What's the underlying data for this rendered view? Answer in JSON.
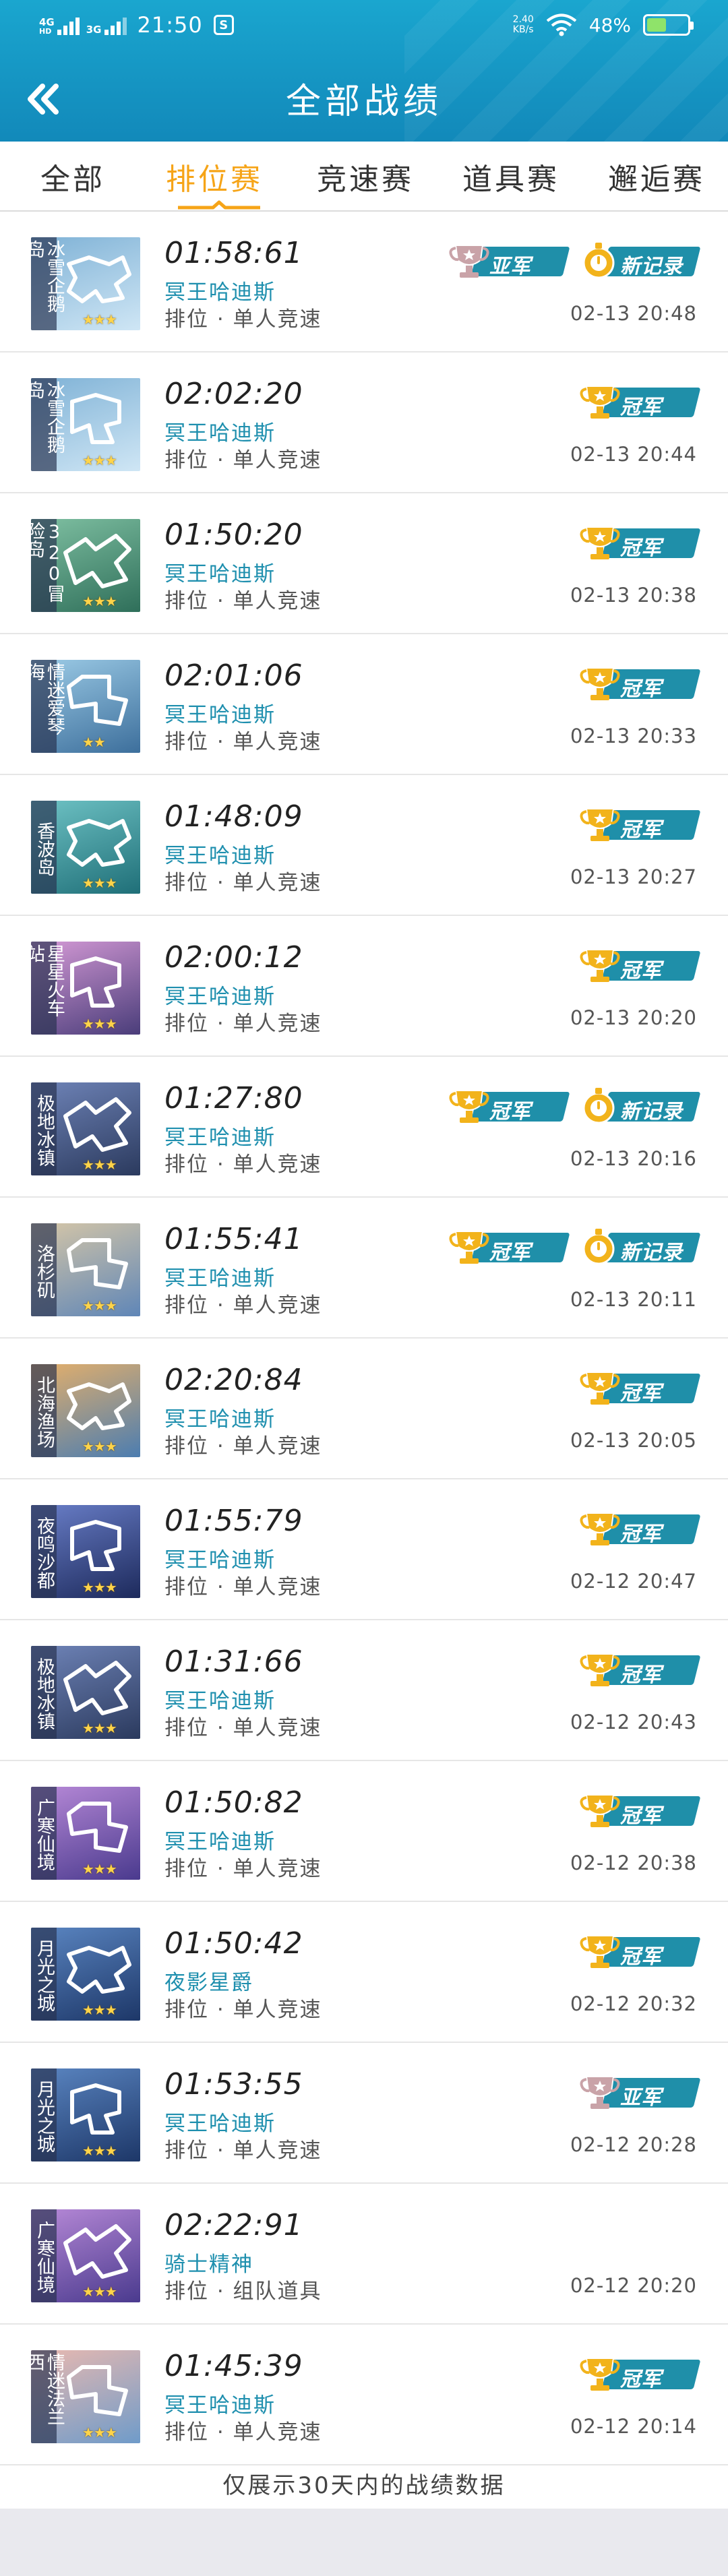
{
  "status_bar": {
    "network_left": "4G",
    "network_left_hd": "HD",
    "network_right": "3G",
    "time": "21:50",
    "app_icon_letter": "S",
    "speed_value": "2.40",
    "speed_unit": "KB/s",
    "battery_text": "48%",
    "battery_level": 0.48,
    "battery_color": "#8fe36a"
  },
  "header": {
    "title": "全部战绩",
    "back_icon": "double-chevron-left-icon",
    "bg_color": "#1594c2"
  },
  "tabs": [
    {
      "label": "全部",
      "active": false
    },
    {
      "label": "排位赛",
      "active": true
    },
    {
      "label": "竞速赛",
      "active": false
    },
    {
      "label": "道具赛",
      "active": false
    },
    {
      "label": "邂逅赛",
      "active": false
    }
  ],
  "colors": {
    "active_tab": "#f6a417",
    "car_name": "#1e8fae",
    "ribbon": "#1f8fa9",
    "gold": "#f2b31b",
    "silver": "#c9a3a8"
  },
  "records": [
    {
      "map": "冰雪企鹅岛",
      "stars": "★★★",
      "time": "01:58:61",
      "car": "冥王哈迪斯",
      "mode": "排位 · 单人竞速",
      "date": "02-13 20:48",
      "badges": [
        {
          "type": "silver",
          "label": "亚军"
        },
        {
          "type": "record",
          "label": "新记录"
        }
      ],
      "thumb": "snow"
    },
    {
      "map": "冰雪企鹅岛",
      "stars": "★★★",
      "time": "02:02:20",
      "car": "冥王哈迪斯",
      "mode": "排位 · 单人竞速",
      "date": "02-13 20:44",
      "badges": [
        {
          "type": "gold",
          "label": "冠军"
        }
      ],
      "thumb": "snow"
    },
    {
      "map": "320冒险岛",
      "stars": "★★★",
      "time": "01:50:20",
      "car": "冥王哈迪斯",
      "mode": "排位 · 单人竞速",
      "date": "02-13 20:38",
      "badges": [
        {
          "type": "gold",
          "label": "冠军"
        }
      ],
      "thumb": "green"
    },
    {
      "map": "情迷爱琴海",
      "stars": "★★",
      "time": "02:01:06",
      "car": "冥王哈迪斯",
      "mode": "排位 · 单人竞速",
      "date": "02-13 20:33",
      "badges": [
        {
          "type": "gold",
          "label": "冠军"
        }
      ],
      "thumb": "sea"
    },
    {
      "map": "香波岛",
      "stars": "★★★",
      "time": "01:48:09",
      "car": "冥王哈迪斯",
      "mode": "排位 · 单人竞速",
      "date": "02-13 20:27",
      "badges": [
        {
          "type": "gold",
          "label": "冠军"
        }
      ],
      "thumb": "teal"
    },
    {
      "map": "星星火车站",
      "stars": "★★★",
      "time": "02:00:12",
      "car": "冥王哈迪斯",
      "mode": "排位 · 单人竞速",
      "date": "02-13 20:20",
      "badges": [
        {
          "type": "gold",
          "label": "冠军"
        }
      ],
      "thumb": "purple"
    },
    {
      "map": "极地冰镇",
      "stars": "★★★",
      "time": "01:27:80",
      "car": "冥王哈迪斯",
      "mode": "排位 · 单人竞速",
      "date": "02-13 20:16",
      "badges": [
        {
          "type": "gold",
          "label": "冠军"
        },
        {
          "type": "record",
          "label": "新记录"
        }
      ],
      "thumb": "night"
    },
    {
      "map": "洛杉矶",
      "stars": "★★★",
      "time": "01:55:41",
      "car": "冥王哈迪斯",
      "mode": "排位 · 单人竞速",
      "date": "02-13 20:11",
      "badges": [
        {
          "type": "gold",
          "label": "冠军"
        },
        {
          "type": "record",
          "label": "新记录"
        }
      ],
      "thumb": "city"
    },
    {
      "map": "北海渔场",
      "stars": "★★★",
      "time": "02:20:84",
      "car": "冥王哈迪斯",
      "mode": "排位 · 单人竞速",
      "date": "02-13 20:05",
      "badges": [
        {
          "type": "gold",
          "label": "冠军"
        }
      ],
      "thumb": "harbor"
    },
    {
      "map": "夜鸣沙都",
      "stars": "★★★",
      "time": "01:55:79",
      "car": "冥王哈迪斯",
      "mode": "排位 · 单人竞速",
      "date": "02-12 20:47",
      "badges": [
        {
          "type": "gold",
          "label": "冠军"
        }
      ],
      "thumb": "desert"
    },
    {
      "map": "极地冰镇",
      "stars": "★★★",
      "time": "01:31:66",
      "car": "冥王哈迪斯",
      "mode": "排位 · 单人竞速",
      "date": "02-12 20:43",
      "badges": [
        {
          "type": "gold",
          "label": "冠军"
        }
      ],
      "thumb": "night"
    },
    {
      "map": "广寒仙境",
      "stars": "★★★",
      "time": "01:50:82",
      "car": "冥王哈迪斯",
      "mode": "排位 · 单人竞速",
      "date": "02-12 20:38",
      "badges": [
        {
          "type": "gold",
          "label": "冠军"
        }
      ],
      "thumb": "violet"
    },
    {
      "map": "月光之城",
      "stars": "★★★",
      "time": "01:50:42",
      "car": "夜影星爵",
      "mode": "排位 · 单人竞速",
      "date": "02-12 20:32",
      "badges": [
        {
          "type": "gold",
          "label": "冠军"
        }
      ],
      "thumb": "moon"
    },
    {
      "map": "月光之城",
      "stars": "★★★",
      "time": "01:53:55",
      "car": "冥王哈迪斯",
      "mode": "排位 · 单人竞速",
      "date": "02-12 20:28",
      "badges": [
        {
          "type": "silver",
          "label": "亚军"
        }
      ],
      "thumb": "moon"
    },
    {
      "map": "广寒仙境",
      "stars": "★★★",
      "time": "02:22:91",
      "car": "骑士精神",
      "mode": "排位 · 组队道具",
      "date": "02-12 20:20",
      "badges": [],
      "thumb": "violet"
    },
    {
      "map": "情迷法兰西",
      "stars": "★★★",
      "time": "01:45:39",
      "car": "冥王哈迪斯",
      "mode": "排位 · 单人竞速",
      "date": "02-12 20:14",
      "badges": [
        {
          "type": "gold",
          "label": "冠军"
        }
      ],
      "thumb": "paris"
    }
  ],
  "footer_note": "仅展示30天内的战绩数据"
}
